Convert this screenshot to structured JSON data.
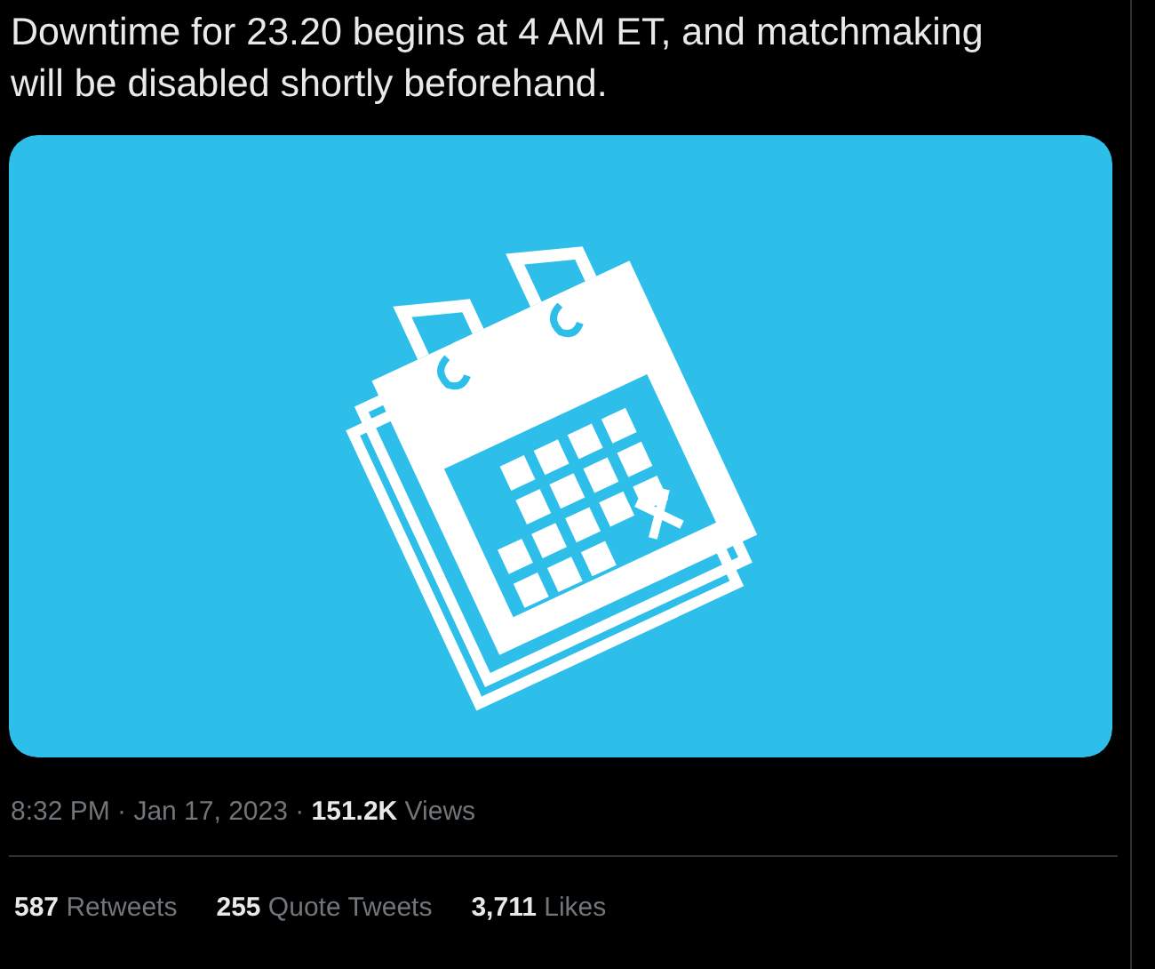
{
  "tweet": {
    "text": "Downtime for 23.20 begins at 4 AM ET, and matchmaking will be disabled shortly beforehand.",
    "media": {
      "kind": "illustration"
    },
    "meta": "8:32 PM · Jan 17, 2023 · **151.2K** Views",
    "stats": [
      {
        "text": "**587** Retweets"
      },
      {
        "text": "**255** Quote Tweets"
      },
      {
        "text": "**3,711** Likes"
      }
    ]
  }
}
